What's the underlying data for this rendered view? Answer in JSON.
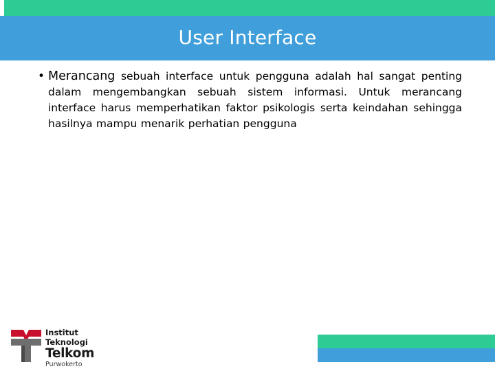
{
  "slide": {
    "header": {
      "title": "User Interface",
      "accent_color": "#2ECC94",
      "bar_color": "#409FDB",
      "title_color": "#FFFFFF"
    },
    "body": {
      "bullet_glyph": "•",
      "lead_word": "Merancang",
      "text": " sebuah interface untuk pengguna adalah hal sangat penting dalam mengembangkan sebuah sistem informasi. Untuk merancang interface harus memperhatikan faktor psikologis serta keindahan sehingga hasilnya mampu menarik perhatian pengguna",
      "full_text": "Merancang sebuah interface untuk pengguna adalah hal sangat penting dalam mengembangkan sebuah sistem informasi. Untuk merancang interface harus memperhatikan faktor psikologis serta keindahan sehingga hasilnya mampu menarik perhatian pengguna",
      "lines": [
        "• Merancang sebuah interface untuk pengguna adalah hal sangat",
        "penting dalam mengembangkan sebuah sistem informasi. Untuk",
        "merancang interface harus memperhatikan faktor psikologis",
        "serta keindahan sehingga hasilnya mampu menarik perhatian",
        "pengguna"
      ],
      "text_color": "#000000"
    },
    "logo": {
      "line1": "Institut",
      "line2": "Teknologi",
      "line3": "Telkom",
      "line4": "Purwokerto",
      "mark_red": "#C8102E",
      "mark_gray": "#6E6E6E",
      "mark_dark": "#4A4A4A"
    },
    "footer": {
      "green_color": "#2ECC94",
      "blue_color": "#409FDB"
    }
  }
}
